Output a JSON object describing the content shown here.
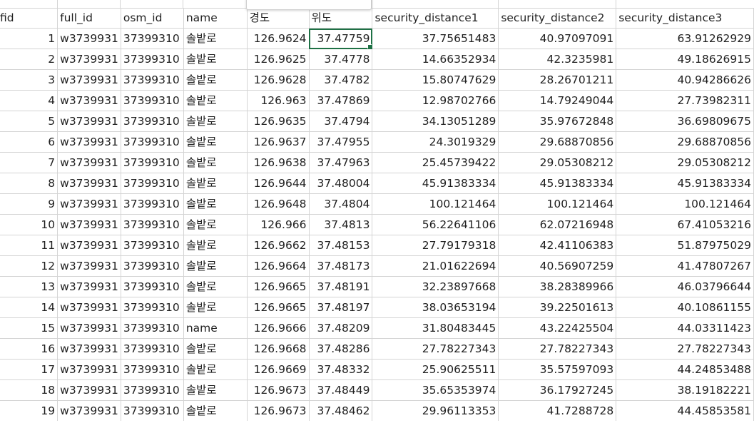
{
  "sheet": {
    "active_cell": {
      "row": 0,
      "col": 5
    },
    "accent_color": "#1e7145",
    "columns": [
      "fid",
      "full_id",
      "osm_id",
      "name",
      "경도",
      "위도",
      "security_distance1",
      "security_distance2",
      "security_distance3"
    ],
    "rows": [
      [
        "1",
        "w3739931",
        "37399310",
        "솔밭로",
        "126.9624",
        "37.47759",
        "37.75651483",
        "40.97097091",
        "63.91262929"
      ],
      [
        "2",
        "w3739931",
        "37399310",
        "솔밭로",
        "126.9625",
        "37.4778",
        "14.66352934",
        "42.3235981",
        "49.18626915"
      ],
      [
        "3",
        "w3739931",
        "37399310",
        "솔밭로",
        "126.9628",
        "37.4782",
        "15.80747629",
        "28.26701211",
        "40.94286626"
      ],
      [
        "4",
        "w3739931",
        "37399310",
        "솔밭로",
        "126.963",
        "37.47869",
        "12.98702766",
        "14.79249044",
        "27.73982311"
      ],
      [
        "5",
        "w3739931",
        "37399310",
        "솔밭로",
        "126.9635",
        "37.4794",
        "34.13051289",
        "35.97672848",
        "36.69809675"
      ],
      [
        "6",
        "w3739931",
        "37399310",
        "솔밭로",
        "126.9637",
        "37.47955",
        "24.3019329",
        "29.68870856",
        "29.68870856"
      ],
      [
        "7",
        "w3739931",
        "37399310",
        "솔밭로",
        "126.9638",
        "37.47963",
        "25.45739422",
        "29.05308212",
        "29.05308212"
      ],
      [
        "8",
        "w3739931",
        "37399310",
        "솔밭로",
        "126.9644",
        "37.48004",
        "45.91383334",
        "45.91383334",
        "45.91383334"
      ],
      [
        "9",
        "w3739931",
        "37399310",
        "솔밭로",
        "126.9648",
        "37.4804",
        "100.121464",
        "100.121464",
        "100.121464"
      ],
      [
        "10",
        "w3739931",
        "37399310",
        "솔밭로",
        "126.966",
        "37.4813",
        "56.22641106",
        "62.07216948",
        "67.41053216"
      ],
      [
        "11",
        "w3739931",
        "37399310",
        "솔밭로",
        "126.9662",
        "37.48153",
        "27.79179318",
        "42.41106383",
        "51.87975029"
      ],
      [
        "12",
        "w3739931",
        "37399310",
        "솔밭로",
        "126.9664",
        "37.48173",
        "21.01622694",
        "40.56907259",
        "41.47807267"
      ],
      [
        "13",
        "w3739931",
        "37399310",
        "솔밭로",
        "126.9665",
        "37.48191",
        "32.23897668",
        "38.28389966",
        "46.03796644"
      ],
      [
        "14",
        "w3739931",
        "37399310",
        "솔밭로",
        "126.9665",
        "37.48197",
        "38.03653194",
        "39.22501613",
        "40.10861155"
      ],
      [
        "15",
        "w3739931",
        "37399310",
        "name",
        "126.9666",
        "37.48209",
        "31.80483445",
        "43.22425504",
        "44.03311423"
      ],
      [
        "16",
        "w3739931",
        "37399310",
        "솔밭로",
        "126.9668",
        "37.48286",
        "27.78227343",
        "27.78227343",
        "27.78227343"
      ],
      [
        "17",
        "w3739931",
        "37399310",
        "솔밭로",
        "126.9669",
        "37.48332",
        "25.90625511",
        "35.57597093",
        "44.24853488"
      ],
      [
        "18",
        "w3739931",
        "37399310",
        "솔밭로",
        "126.9673",
        "37.48449",
        "35.65353974",
        "36.17927245",
        "38.19182221"
      ],
      [
        "19",
        "w3739931",
        "37399310",
        "솔밭로",
        "126.9673",
        "37.48462",
        "29.96113353",
        "41.7288728",
        "44.45853581"
      ]
    ]
  }
}
